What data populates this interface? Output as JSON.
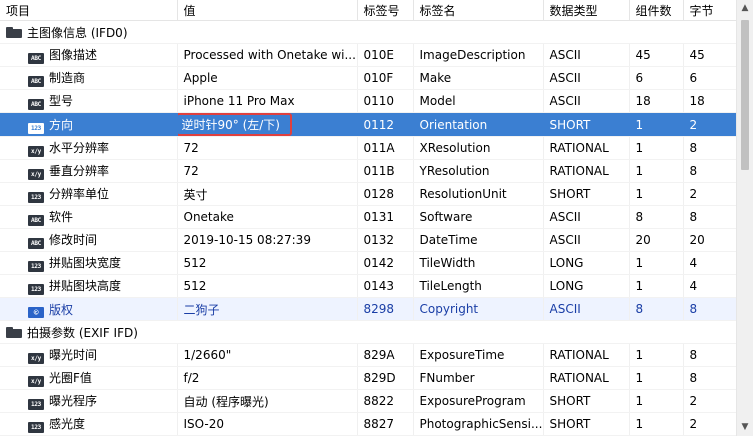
{
  "columns": [
    "项目",
    "值",
    "标签号",
    "标签名",
    "数据类型",
    "组件数",
    "字节"
  ],
  "groups": [
    {
      "title": "主图像信息 (IFD0)",
      "rows": [
        {
          "icon": "ABC",
          "name": "图像描述",
          "value": "Processed with Onetake wi...",
          "tag": "010E",
          "tagname": "ImageDescription",
          "type": "ASCII",
          "count": "45",
          "bytes": "45"
        },
        {
          "icon": "ABC",
          "name": "制造商",
          "value": "Apple",
          "tag": "010F",
          "tagname": "Make",
          "type": "ASCII",
          "count": "6",
          "bytes": "6"
        },
        {
          "icon": "ABC",
          "name": "型号",
          "value": "iPhone 11 Pro Max",
          "tag": "0110",
          "tagname": "Model",
          "type": "ASCII",
          "count": "18",
          "bytes": "18"
        },
        {
          "icon": "123",
          "name": "方向",
          "value": "逆时针90° (左/下)",
          "tag": "0112",
          "tagname": "Orientation",
          "type": "SHORT",
          "count": "1",
          "bytes": "2",
          "selected": true
        },
        {
          "icon": "x/y",
          "name": "水平分辨率",
          "value": "72",
          "tag": "011A",
          "tagname": "XResolution",
          "type": "RATIONAL",
          "count": "1",
          "bytes": "8"
        },
        {
          "icon": "x/y",
          "name": "垂直分辨率",
          "value": "72",
          "tag": "011B",
          "tagname": "YResolution",
          "type": "RATIONAL",
          "count": "1",
          "bytes": "8"
        },
        {
          "icon": "123",
          "name": "分辨率单位",
          "value": "英寸",
          "tag": "0128",
          "tagname": "ResolutionUnit",
          "type": "SHORT",
          "count": "1",
          "bytes": "2"
        },
        {
          "icon": "ABC",
          "name": "软件",
          "value": "Onetake",
          "tag": "0131",
          "tagname": "Software",
          "type": "ASCII",
          "count": "8",
          "bytes": "8"
        },
        {
          "icon": "ABC",
          "name": "修改时间",
          "value": "2019-10-15 08:27:39",
          "tag": "0132",
          "tagname": "DateTime",
          "type": "ASCII",
          "count": "20",
          "bytes": "20"
        },
        {
          "icon": "123",
          "name": "拼贴图块宽度",
          "value": "512",
          "tag": "0142",
          "tagname": "TileWidth",
          "type": "LONG",
          "count": "1",
          "bytes": "4"
        },
        {
          "icon": "123",
          "name": "拼贴图块高度",
          "value": "512",
          "tag": "0143",
          "tagname": "TileLength",
          "type": "LONG",
          "count": "1",
          "bytes": "4"
        },
        {
          "icon": "©",
          "name": "版权",
          "value": "二狗子",
          "tag": "8298",
          "tagname": "Copyright",
          "type": "ASCII",
          "count": "8",
          "bytes": "8",
          "link": true
        }
      ]
    },
    {
      "title": "拍摄参数 (EXIF IFD)",
      "rows": [
        {
          "icon": "x/y",
          "name": "曝光时间",
          "value": "1/2660\"",
          "tag": "829A",
          "tagname": "ExposureTime",
          "type": "RATIONAL",
          "count": "1",
          "bytes": "8"
        },
        {
          "icon": "x/y",
          "name": "光圈F值",
          "value": "f/2",
          "tag": "829D",
          "tagname": "FNumber",
          "type": "RATIONAL",
          "count": "1",
          "bytes": "8"
        },
        {
          "icon": "123",
          "name": "曝光程序",
          "value": "自动 (程序曝光)",
          "tag": "8822",
          "tagname": "ExposureProgram",
          "type": "SHORT",
          "count": "1",
          "bytes": "2"
        },
        {
          "icon": "123",
          "name": "感光度",
          "value": "ISO-20",
          "tag": "8827",
          "tagname": "PhotographicSensi...",
          "type": "SHORT",
          "count": "1",
          "bytes": "2"
        }
      ]
    }
  ],
  "scrollbar": {
    "up_glyph": "▲",
    "down_glyph": "▼"
  }
}
